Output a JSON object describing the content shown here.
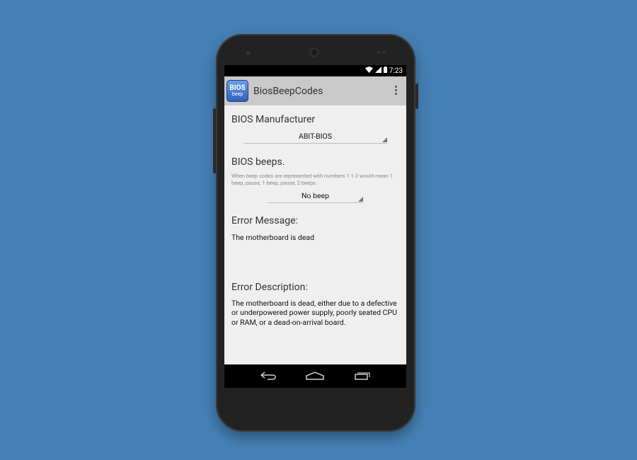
{
  "status_bar": {
    "time": "7:23"
  },
  "action_bar": {
    "app_icon_text_top": "BIOS",
    "app_icon_text_bottom": "beep",
    "title": "BiosBeepCodes"
  },
  "manufacturer": {
    "label": "BIOS Manufacturer",
    "selected": "ABIT-BIOS"
  },
  "beeps": {
    "label": "BIOS beeps.",
    "hint": "When beep codes are represented with numbers 1-1-2 would mean 1 beep, pause, 1 beep, pause, 2 beeps.",
    "selected": "No beep"
  },
  "error_message": {
    "label": "Error Message:",
    "value": "The motherboard is dead"
  },
  "error_description": {
    "label": "Error Description:",
    "value": "The motherboard is dead, either due to a defective or underpowered power supply, poorly seated CPU or RAM, or a dead-on-arrival board."
  },
  "icons": {
    "wifi": "wifi-icon",
    "signal": "signal-icon",
    "battery": "battery-icon",
    "overflow": "overflow-menu-icon",
    "back": "back-icon",
    "home": "home-icon",
    "recents": "recents-icon"
  }
}
